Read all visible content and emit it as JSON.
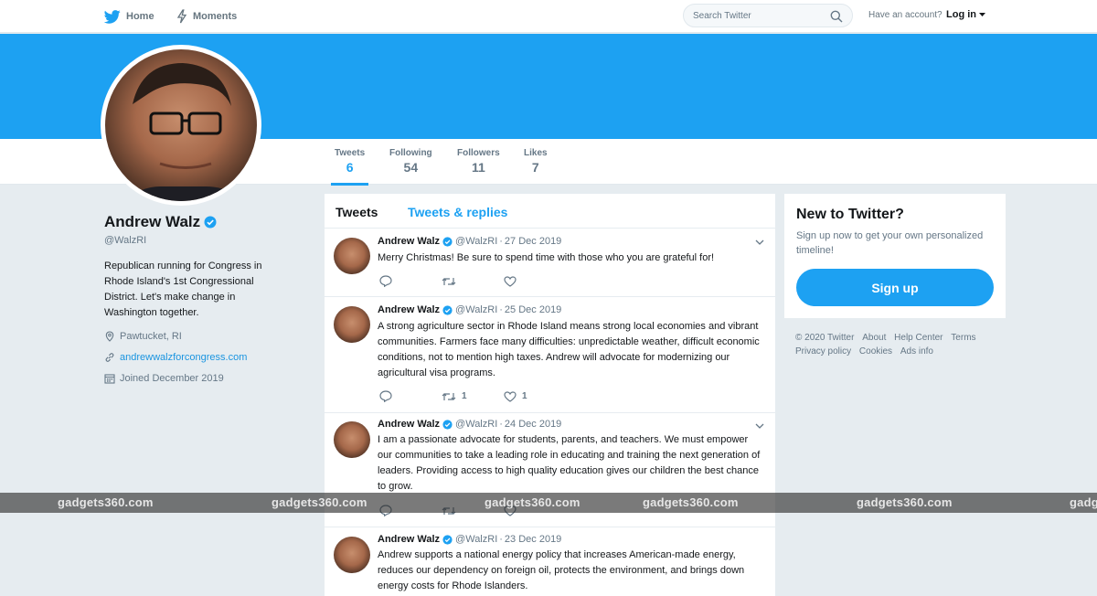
{
  "nav": {
    "home": "Home",
    "moments": "Moments",
    "search_placeholder": "Search Twitter",
    "have_account": "Have an account?",
    "login": "Log in"
  },
  "colors": {
    "brand": "#1da1f2",
    "link": "#1b95e0"
  },
  "profile": {
    "name": "Andrew Walz",
    "handle": "@WalzRI",
    "bio": "Republican running for Congress in Rhode Island's 1st Congressional District. Let's make change in Washington together.",
    "location": "Pawtucket, RI",
    "url": "andrewwalzforcongress.com",
    "joined": "Joined December 2019"
  },
  "stats": [
    {
      "label": "Tweets",
      "value": "6"
    },
    {
      "label": "Following",
      "value": "54"
    },
    {
      "label": "Followers",
      "value": "11"
    },
    {
      "label": "Likes",
      "value": "7"
    }
  ],
  "timeline": {
    "tab_tweets": "Tweets",
    "tab_replies": "Tweets & replies",
    "tweets": [
      {
        "name": "Andrew Walz",
        "handle": "@WalzRI",
        "sep": "·",
        "date": "27 Dec 2019",
        "text": "Merry Christmas! Be sure to spend time with those who you are grateful for!",
        "retweets": "",
        "likes": ""
      },
      {
        "name": "Andrew Walz",
        "handle": "@WalzRI",
        "sep": "·",
        "date": "25 Dec 2019",
        "text": "A strong agriculture sector in Rhode Island means strong local economies and vibrant communities. Farmers face many difficulties: unpredictable weather, difficult economic conditions, not to mention high taxes. Andrew will advocate for modernizing our agricultural visa programs.",
        "retweets": "1",
        "likes": "1"
      },
      {
        "name": "Andrew Walz",
        "handle": "@WalzRI",
        "sep": "·",
        "date": "24 Dec 2019",
        "text": "I am a passionate advocate for students, parents, and teachers. We must empower our communities to take a leading role in educating and training the next generation of leaders. Providing access to high quality education gives our children the best chance to grow.",
        "retweets": "",
        "likes": ""
      },
      {
        "name": "Andrew Walz",
        "handle": "@WalzRI",
        "sep": "·",
        "date": "23 Dec 2019",
        "text": "Andrew supports a national energy policy that increases American-made energy, reduces our dependency on foreign oil, protects the environment, and brings down energy costs for Rhode Islanders.",
        "retweets": "",
        "likes": ""
      }
    ]
  },
  "signup": {
    "title": "New to Twitter?",
    "subtitle": "Sign up now to get your own personalized timeline!",
    "button": "Sign up"
  },
  "footer": [
    "© 2020 Twitter",
    "About",
    "Help Center",
    "Terms",
    "Privacy policy",
    "Cookies",
    "Ads info"
  ],
  "watermark": [
    "gadgets360.com",
    "gadgets360.com",
    "gadgets360.com",
    "gadgets360.com",
    "gadgets360.com",
    "gadg"
  ]
}
